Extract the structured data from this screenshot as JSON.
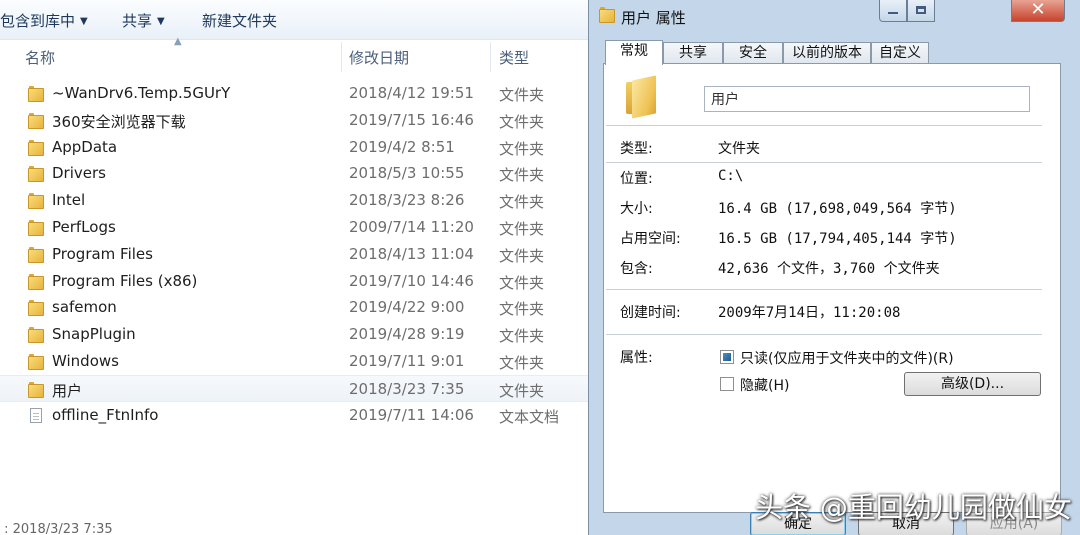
{
  "explorer": {
    "toolbar": {
      "include_library": "包含到库中",
      "share": "共享",
      "new_folder": "新建文件夹"
    },
    "columns": {
      "name": "名称",
      "date": "修改日期",
      "type": "类型"
    },
    "items": [
      {
        "name": "~WanDrv6.Temp.5GUrY",
        "date": "2018/4/12 19:51",
        "type": "文件夹",
        "icon": "folder"
      },
      {
        "name": "360安全浏览器下载",
        "date": "2019/7/15 16:46",
        "type": "文件夹",
        "icon": "folder"
      },
      {
        "name": "AppData",
        "date": "2019/4/2 8:51",
        "type": "文件夹",
        "icon": "folder"
      },
      {
        "name": "Drivers",
        "date": "2018/5/3 10:55",
        "type": "文件夹",
        "icon": "folder"
      },
      {
        "name": "Intel",
        "date": "2018/3/23 8:26",
        "type": "文件夹",
        "icon": "folder"
      },
      {
        "name": "PerfLogs",
        "date": "2009/7/14 11:20",
        "type": "文件夹",
        "icon": "folder"
      },
      {
        "name": "Program Files",
        "date": "2018/4/13 11:04",
        "type": "文件夹",
        "icon": "folder"
      },
      {
        "name": "Program Files (x86)",
        "date": "2019/7/10 14:46",
        "type": "文件夹",
        "icon": "folder"
      },
      {
        "name": "safemon",
        "date": "2019/4/22 9:00",
        "type": "文件夹",
        "icon": "folder"
      },
      {
        "name": "SnapPlugin",
        "date": "2019/4/28 9:19",
        "type": "文件夹",
        "icon": "folder"
      },
      {
        "name": "Windows",
        "date": "2019/7/11 9:01",
        "type": "文件夹",
        "icon": "folder"
      },
      {
        "name": "用户",
        "date": "2018/3/23 7:35",
        "type": "文件夹",
        "icon": "folder",
        "selected": true
      },
      {
        "name": "offline_FtnInfo",
        "date": "2019/7/11 14:06",
        "type": "文本文档",
        "icon": "text-document"
      }
    ],
    "status_text": " : 2018/3/23 7:35"
  },
  "dialog": {
    "title": "用户 属性",
    "close_glyph": "✕",
    "tabs": [
      "常规",
      "共享",
      "安全",
      "以前的版本",
      "自定义"
    ],
    "active_tab": "常规",
    "folder_name": "用户",
    "fields": {
      "type_label": "类型:",
      "type_value": "文件夹",
      "location_label": "位置:",
      "location_value": "C:\\",
      "size_label": "大小:",
      "size_value": "16.4 GB (17,698,049,564 字节)",
      "disk_size_label": "占用空间:",
      "disk_size_value": "16.5 GB (17,794,405,144 字节)",
      "contains_label": "包含:",
      "contains_value": "42,636 个文件，3,760 个文件夹",
      "created_label": "创建时间:",
      "created_value": "2009年7月14日，11:20:08",
      "attributes_label": "属性:"
    },
    "attributes": {
      "readonly_label": "只读(仅应用于文件夹中的文件)(R)",
      "readonly_state": "indeterminate",
      "hidden_label": "隐藏(H)",
      "hidden_checked": false,
      "advanced_button": "高级(D)..."
    },
    "buttons": {
      "ok": "确定",
      "cancel": "取消",
      "apply": "应用(A)"
    }
  },
  "watermark": "头条 @重回幼儿园做仙女"
}
